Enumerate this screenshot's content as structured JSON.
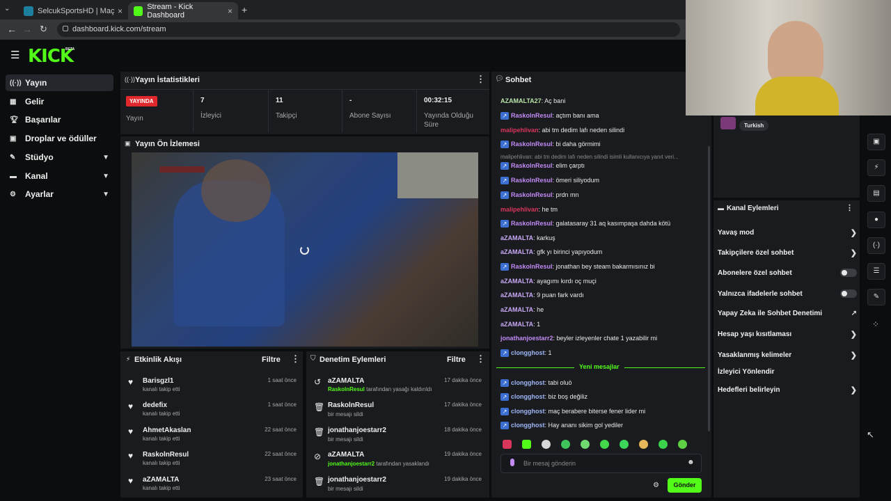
{
  "browser": {
    "tabs": [
      {
        "title": "SelcukSportsHD | Maç Yayı",
        "close": "×"
      },
      {
        "title": "Stream - Kick Dashboard",
        "close": "×"
      }
    ],
    "new_tab": "+",
    "url": "dashboard.kick.com/stream"
  },
  "header": {
    "logo": "KICK",
    "beta": "BETA"
  },
  "sidebar": {
    "items": [
      {
        "label": "Yayın"
      },
      {
        "label": "Gelir"
      },
      {
        "label": "Başarılar"
      },
      {
        "label": "Droplar ve ödüller"
      },
      {
        "label": "Stüdyo"
      },
      {
        "label": "Kanal"
      },
      {
        "label": "Ayarlar"
      }
    ]
  },
  "stats": {
    "title": "Yayın İstatistikleri",
    "live_badge": "YAYINDA",
    "live_label": "Yayın",
    "items": [
      {
        "value": "7",
        "label": "İzleyici"
      },
      {
        "value": "11",
        "label": "Takipçi"
      },
      {
        "value": "-",
        "label": "Abone Sayısı"
      },
      {
        "value": "00:32:15",
        "label": "Yayında Olduğu Süre"
      }
    ]
  },
  "preview": {
    "title": "Yayın Ön İzlemesi"
  },
  "activity": {
    "title": "Etkinlik Akışı",
    "filter": "Filtre",
    "rows": [
      {
        "name": "Barisgzl1",
        "sub": "kanalı takip etti",
        "time": "1 saat önce"
      },
      {
        "name": "dedefix",
        "sub": "kanalı takip etti",
        "time": "1 saat önce"
      },
      {
        "name": "AhmetAkaslan",
        "sub": "kanalı takip etti",
        "time": "22 saat önce"
      },
      {
        "name": "RaskolnResul",
        "sub": "kanalı takip etti",
        "time": "22 saat önce"
      },
      {
        "name": "aZAMALTA",
        "sub": "kanalı takip etti",
        "time": "23 saat önce"
      }
    ]
  },
  "moderation": {
    "title": "Denetim Eylemleri",
    "filter": "Filtre",
    "rows": [
      {
        "name": "aZAMALTA",
        "target": "RaskolnResul",
        "sub": "tarafından yasağı kaldırıldı",
        "time": "17 dakika önce"
      },
      {
        "name": "RaskolnResul",
        "target": "",
        "sub": "bir mesajı sildi",
        "time": "17 dakika önce"
      },
      {
        "name": "jonathanjoestarr2",
        "target": "",
        "sub": "bir mesajı sildi",
        "time": "18 dakika önce"
      },
      {
        "name": "aZAMALTA",
        "target": "jonathanjoestarr2",
        "sub": "tarafından yasaklandı",
        "time": "19 dakika önce"
      },
      {
        "name": "jonathanjoestarr2",
        "target": "",
        "sub": "bir mesajı sildi",
        "time": "19 dakika önce"
      }
    ]
  },
  "chat": {
    "title": "Sohbet",
    "messages": [
      {
        "user": "AZAMALTA27",
        "text": ": Aç bani",
        "color": "#b9e3a7",
        "badge": false
      },
      {
        "user": "RaskolnResul",
        "text": ": açtım banı ama",
        "color": "#c38bf5",
        "badge": true
      },
      {
        "user": "malipehlivan",
        "text": ": abi tm dedim lafı neden silindi",
        "color": "#d9365b",
        "badge": false
      },
      {
        "user": "RaskolnResul",
        "text": ": bi daha görmimi",
        "color": "#c38bf5",
        "badge": true
      },
      {
        "user": "RaskolnResul",
        "text": ": elim çarptı",
        "color": "#c38bf5",
        "badge": true
      },
      {
        "user": "RaskolnResul",
        "text": ": ömeri siliyodum",
        "color": "#c38bf5",
        "badge": true
      },
      {
        "user": "RaskolnResul",
        "text": ": prdn mn",
        "color": "#c38bf5",
        "badge": true
      },
      {
        "user": "malipehlivan",
        "text": ": he tm",
        "color": "#d9365b",
        "badge": false
      },
      {
        "user": "RaskolnResul",
        "text": ": galatasaray 31 aq kasımpaşa dahda kötü",
        "color": "#c38bf5",
        "badge": true
      },
      {
        "user": "aZAMALTA",
        "text": ": karkuş",
        "color": "#c9a9f5",
        "badge": false
      },
      {
        "user": "aZAMALTA",
        "text": ": gfk yı birinci yapıyodum",
        "color": "#c9a9f5",
        "badge": false
      },
      {
        "user": "RaskolnResul",
        "text": ": jonathan bey steam bakarmısınız bi",
        "color": "#c38bf5",
        "badge": true
      },
      {
        "user": "aZAMALTA",
        "text": ": ayagımı kırdı oç muçi",
        "color": "#c9a9f5",
        "badge": false
      },
      {
        "user": "aZAMALTA",
        "text": ": 9 puan fark vardı",
        "color": "#c9a9f5",
        "badge": false
      },
      {
        "user": "aZAMALTA",
        "text": ": he",
        "color": "#c9a9f5",
        "badge": false
      },
      {
        "user": "aZAMALTA",
        "text": ": 1",
        "color": "#c9a9f5",
        "badge": false
      },
      {
        "user": "jonathanjoestarr2",
        "text": ": beyler izleyenler chate 1 yazabilir mi",
        "color": "#c38bf5",
        "badge": false
      },
      {
        "user": "clongghost",
        "text": ": 1",
        "color": "#9fb6f5",
        "badge": true
      }
    ],
    "reply_preview": "malipehlivan: abi tm dedim lafı neden silindi isimli kullanıcıya yanıt veri...",
    "new_messages": "Yeni mesajlar",
    "new": [
      {
        "user": "clongghost",
        "text": ": tabi oluö",
        "color": "#9fb6f5",
        "badge": true
      },
      {
        "user": "clongghost",
        "text": ": biz boş değiliz",
        "color": "#9fb6f5",
        "badge": true
      },
      {
        "user": "clongghost",
        "text": ": maç berabere biterse fener lider mi",
        "color": "#9fb6f5",
        "badge": true
      },
      {
        "user": "clongghost",
        "text": ": Hay ananı sikim gol yediler",
        "color": "#9fb6f5",
        "badge": true
      }
    ],
    "input_placeholder": "Bir mesaj gönderin",
    "send": "Gönder"
  },
  "language": "Turkish",
  "channel_actions": {
    "title": "Kanal Eylemleri",
    "items": [
      {
        "label": "Yavaş mod",
        "control": "chevron"
      },
      {
        "label": "Takipçilere özel sohbet",
        "control": "chevron"
      },
      {
        "label": "Abonelere özel sohbet",
        "control": "toggle"
      },
      {
        "label": "Yalnızca ifadelerle sohbet",
        "control": "toggle"
      },
      {
        "label": "Yapay Zeka ile Sohbet Denetimi",
        "control": "external"
      },
      {
        "label": "Hesap yaşı kısıtlaması",
        "control": "chevron"
      },
      {
        "label": "Yasaklanmış kelimeler",
        "control": "chevron"
      },
      {
        "label": "İzleyici Yönlendir",
        "control": "none"
      },
      {
        "label": "Hedefleri belirleyin",
        "control": "chevron"
      }
    ]
  },
  "colors": {
    "accent": "#53fc18",
    "live": "#e0282d",
    "panel": "#191b1f"
  }
}
